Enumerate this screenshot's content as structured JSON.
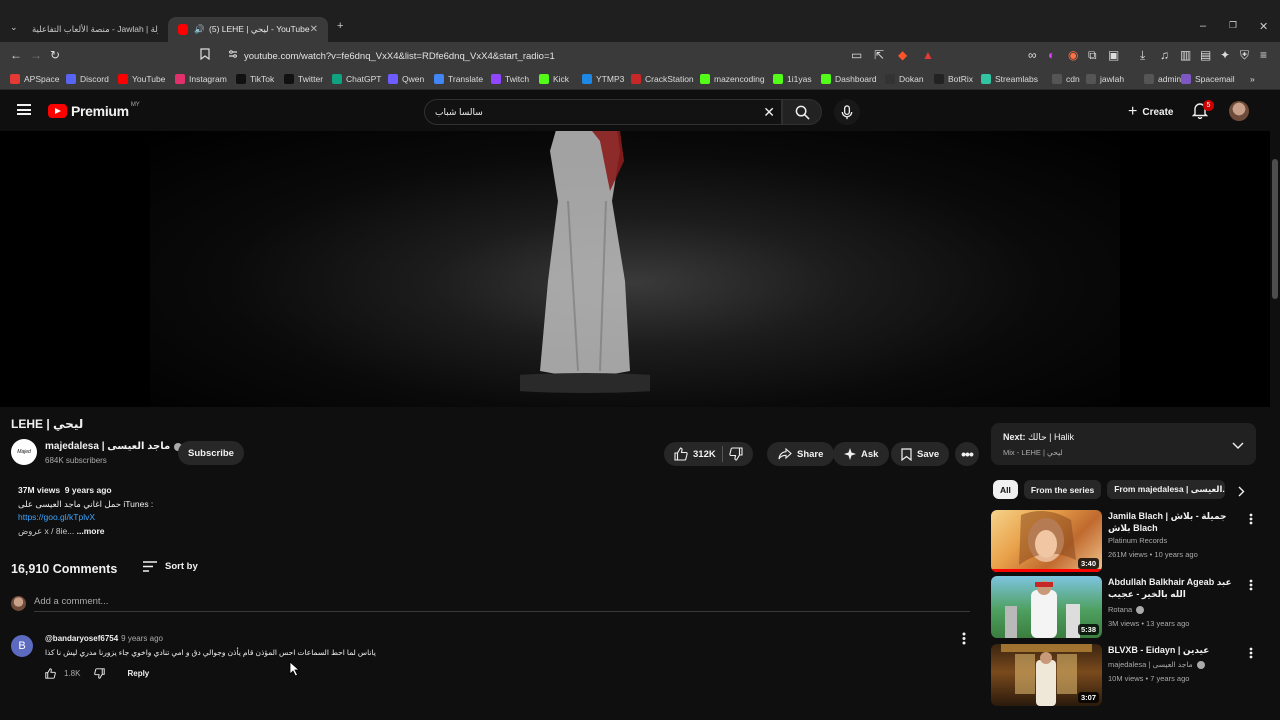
{
  "browser": {
    "tabs": [
      {
        "title": "منصة الألعاب التفاعلية - Jawlah | جولة",
        "active": false
      },
      {
        "title": "(5) LEHE | ليحي - YouTube",
        "active": true
      }
    ],
    "new_tab": "+",
    "url": "youtube.com/watch?v=fe6dnq_VxX4&list=RDfe6dnq_VxX4&start_radio=1",
    "bookmarks": [
      {
        "label": "APSpace",
        "color": "#e53935"
      },
      {
        "label": "Discord",
        "color": "#5865f2"
      },
      {
        "label": "YouTube",
        "color": "#ff0000"
      },
      {
        "label": "Instagram",
        "color": "#e1306c"
      },
      {
        "label": "TikTok",
        "color": "#111111"
      },
      {
        "label": "Twitter",
        "color": "#111111"
      },
      {
        "label": "ChatGPT",
        "color": "#10a37f"
      },
      {
        "label": "Qwen",
        "color": "#6d5cff"
      },
      {
        "label": "Translate",
        "color": "#4285f4"
      },
      {
        "label": "Twitch",
        "color": "#9146ff"
      },
      {
        "label": "Kick",
        "color": "#53fc18"
      },
      {
        "label": "YTMP3",
        "color": "#1e88e5"
      },
      {
        "label": "CrackStation",
        "color": "#c62828"
      },
      {
        "label": "mazencoding",
        "color": "#53fc18"
      },
      {
        "label": "1i1yas",
        "color": "#53fc18"
      },
      {
        "label": "Dashboard",
        "color": "#53fc18"
      },
      {
        "label": "Dokan",
        "color": "#333333"
      },
      {
        "label": "BotRix",
        "color": "#222222"
      },
      {
        "label": "Streamlabs",
        "color": "#31c3a2"
      },
      {
        "label": "cdn",
        "color": "#555555"
      },
      {
        "label": "jawlah",
        "color": "#555555"
      },
      {
        "label": "admin",
        "color": "#555555"
      },
      {
        "label": "Spacemail",
        "color": "#7e57c2"
      }
    ]
  },
  "masthead": {
    "logo_text": "Premium",
    "region": "MY",
    "search_value": "سالسا شباب",
    "create_label": "Create",
    "notifications": "5"
  },
  "video": {
    "title": "LEHE | ليحي",
    "channel_name": "majedalesa | ماجد العيسى",
    "channel_avatar_text": "Majed",
    "subscribers": "684K subscribers",
    "subscribe_label": "Subscribe",
    "likes": "312K",
    "share_label": "Share",
    "ask_label": "Ask",
    "save_label": "Save"
  },
  "description": {
    "views": "37M views",
    "age": "9 years ago",
    "line1": "حمل اغاني ماجد العيسى على iTunes :",
    "link": "https://goo.gl/kTplvX",
    "line3": "عروض  x  /  8ie...",
    "more": "...more"
  },
  "comments": {
    "count_label": "16,910 Comments",
    "sort_label": "Sort by",
    "add_placeholder": "Add a comment...",
    "items": [
      {
        "avatar_letter": "B",
        "author": "@bandaryosef6754",
        "age": "9 years ago",
        "text": "ياناس لما احط السماعات احس المؤذن قام يأذن وجوالي دق و امي تنادي واخوي جاء يزورنا مدري ليش نا كذا",
        "likes": "1.8K",
        "reply_label": "Reply"
      }
    ]
  },
  "sidebar": {
    "next_label": "Next:",
    "next_title": "حالك | Halik",
    "next_sub": "Mix - LEHE | ليحي",
    "chips": [
      "All",
      "From the series",
      "From majedalesa | العيسى..."
    ],
    "recommendations": [
      {
        "title": "Jamila Blach | جميلة - بلاش بلاش Blach",
        "channel": "Platinum Records",
        "verified": false,
        "meta": "261M views • 10 years ago",
        "duration": "3:40"
      },
      {
        "title": "Abdullah Balkhair Ageab عبد الله بالخير - عجيب",
        "channel": "Rotana",
        "verified": true,
        "meta": "3M views • 13 years ago",
        "duration": "5:38"
      },
      {
        "title": "BLVXB - Eidayn | عيدين",
        "channel": "majedalesa | ماجد العيسى",
        "verified": true,
        "meta": "10M views • 7 years ago",
        "duration": "3:07"
      }
    ]
  }
}
